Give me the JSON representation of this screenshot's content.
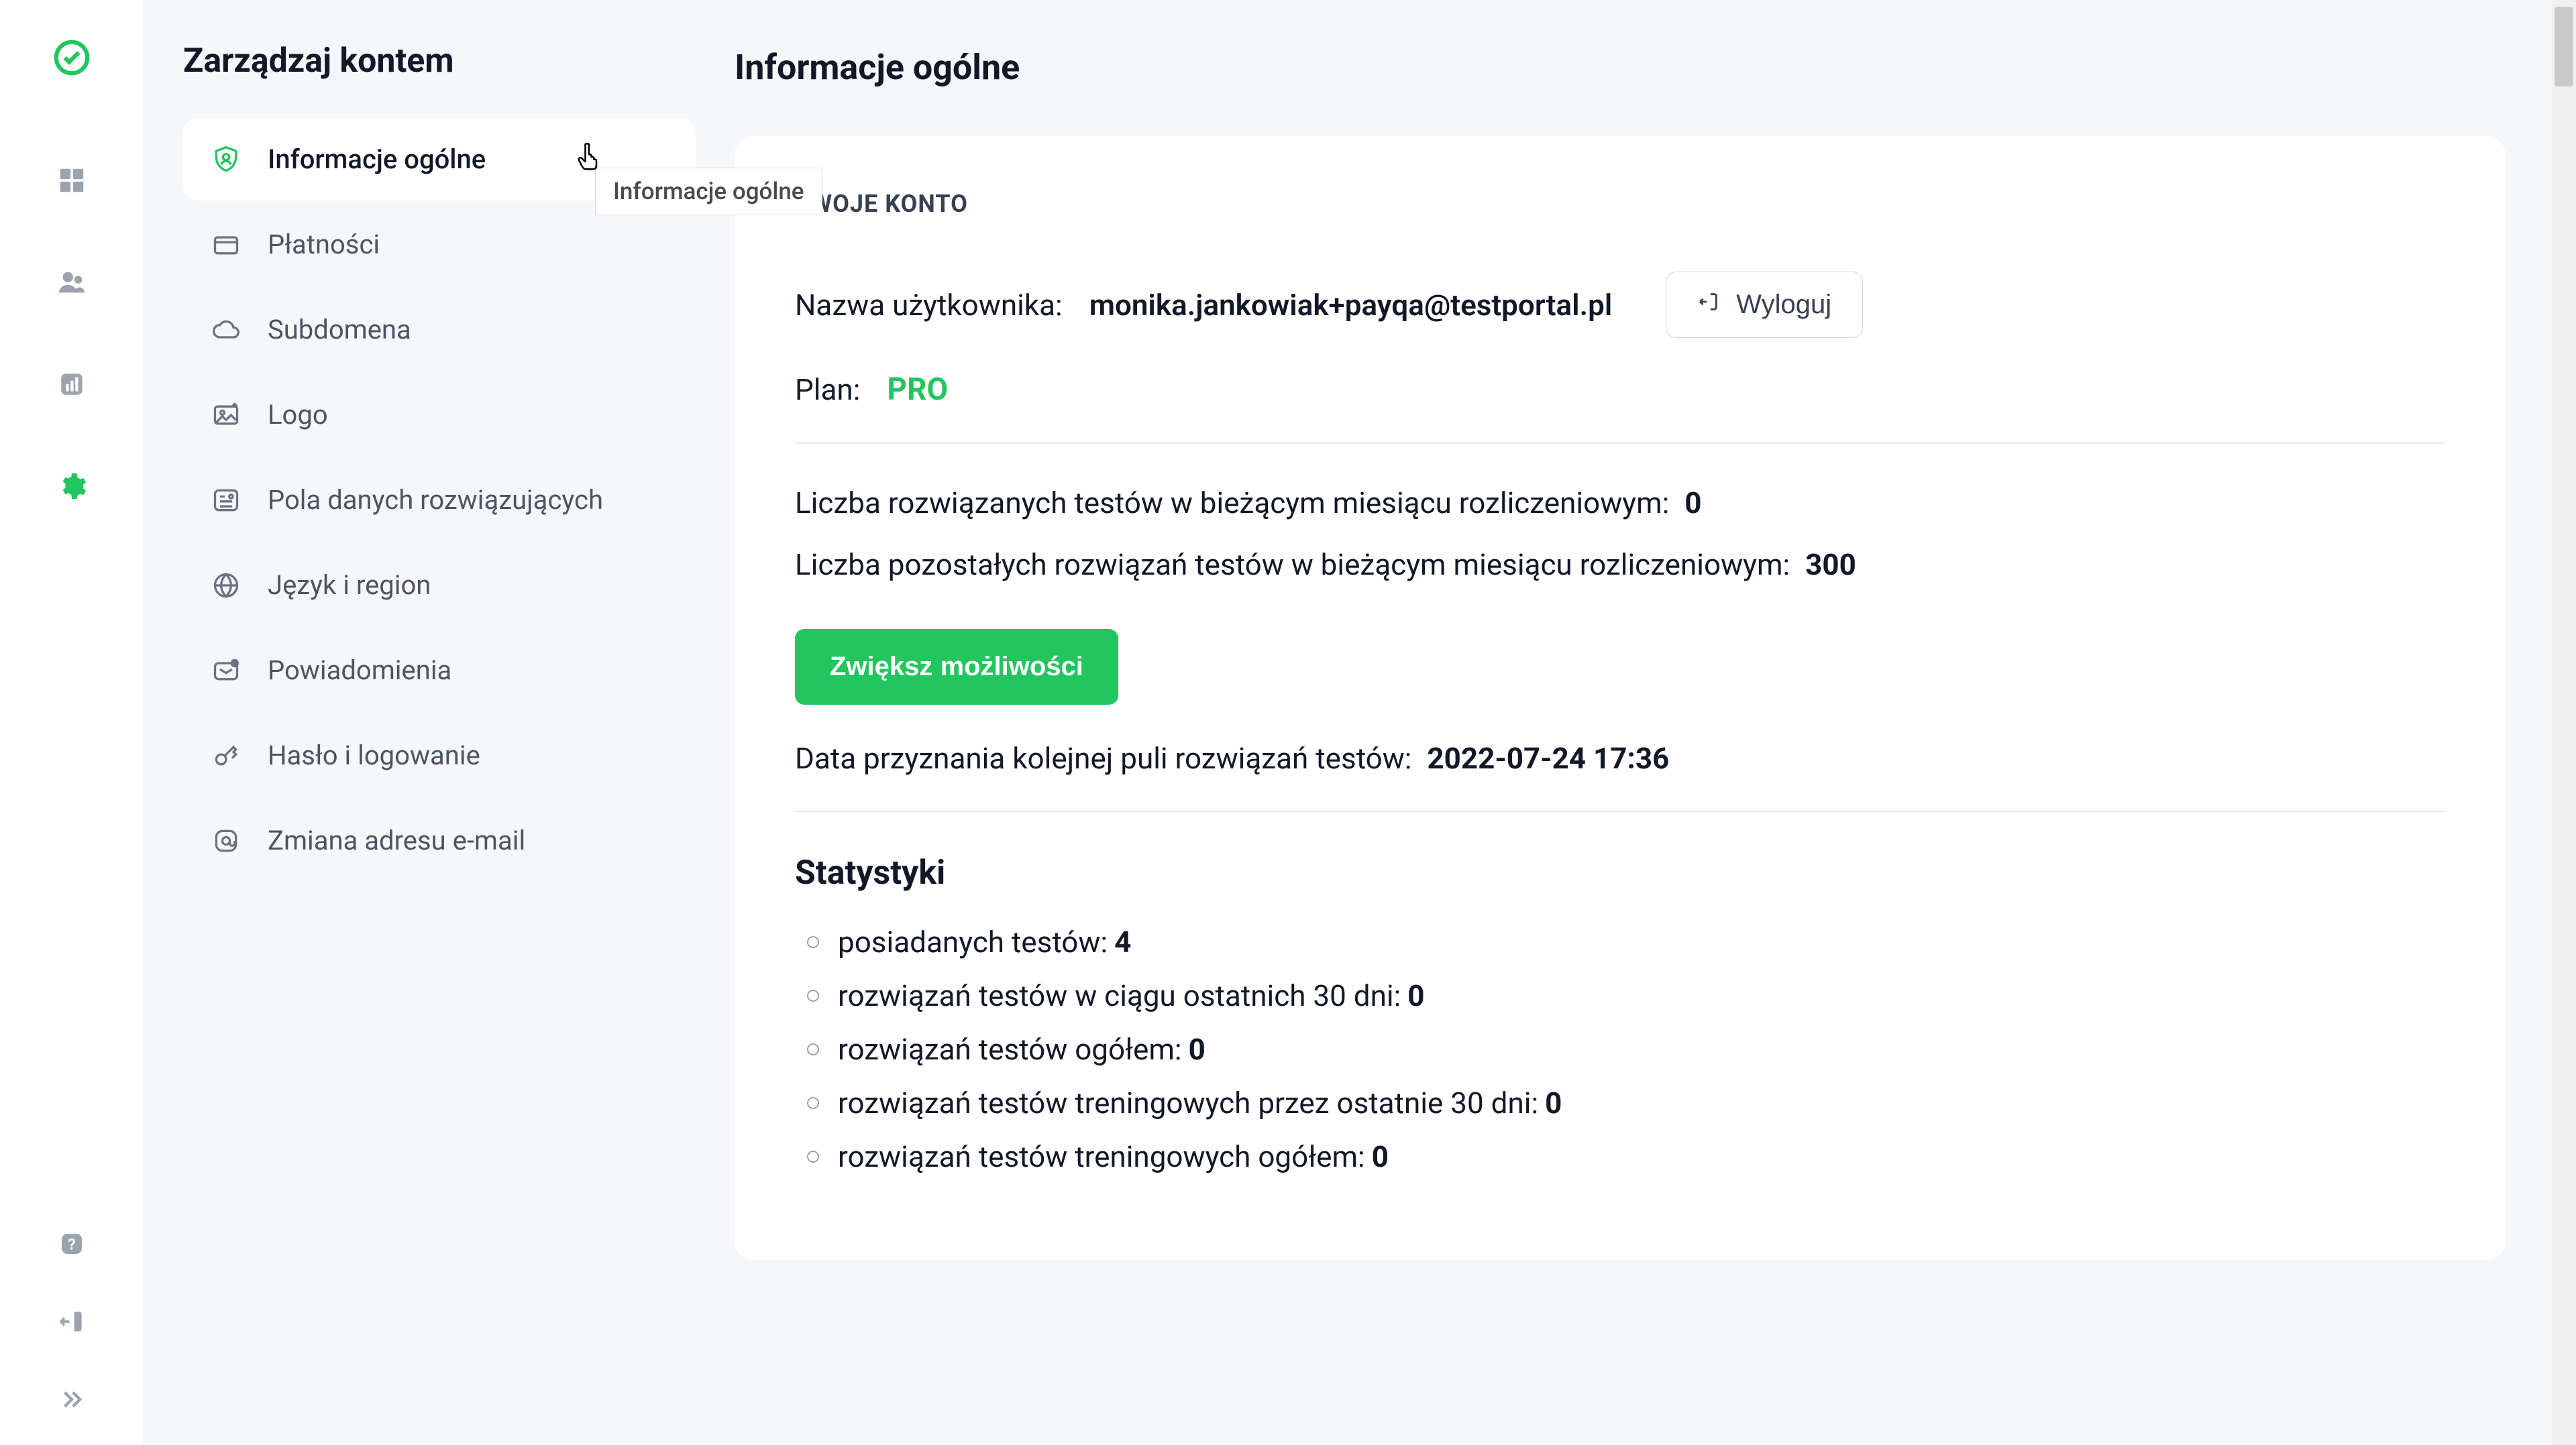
{
  "sidebar_title": "Zarządzaj kontem",
  "page_title": "Informacje ogólne",
  "tooltip_text": "Informacje ogólne",
  "settings_menu": {
    "items": [
      {
        "label": "Informacje ogólne"
      },
      {
        "label": "Płatności"
      },
      {
        "label": "Subdomena"
      },
      {
        "label": "Logo"
      },
      {
        "label": "Pola danych rozwiązujących"
      },
      {
        "label": "Język i region"
      },
      {
        "label": "Powiadomienia"
      },
      {
        "label": "Hasło i logowanie"
      },
      {
        "label": "Zmiana adresu e-mail"
      }
    ]
  },
  "card": {
    "heading": "TWOJE KONTO",
    "username_label": "Nazwa użytkownika:",
    "username_value": "monika.jankowiak+payqa@testportal.pl",
    "logout_label": "Wyloguj",
    "plan_label": "Plan:",
    "plan_value": "PRO",
    "solved_label": "Liczba rozwiązanych testów w bieżącym miesiącu rozliczeniowym:",
    "solved_value": "0",
    "remaining_label": "Liczba pozostałych rozwiązań testów w bieżącym miesiącu rozliczeniowym:",
    "remaining_value": "300",
    "upgrade_label": "Zwiększ możliwości",
    "next_pool_label": "Data przyznania kolejnej puli rozwiązań testów:",
    "next_pool_value": "2022-07-24 17:36",
    "stats_heading": "Statystyki",
    "stats": [
      {
        "label": "posiadanych testów: ",
        "value": "4"
      },
      {
        "label": "rozwiązań testów w ciągu ostatnich 30 dni: ",
        "value": "0"
      },
      {
        "label": "rozwiązań testów ogółem: ",
        "value": "0"
      },
      {
        "label": "rozwiązań testów treningowych przez ostatnie 30 dni: ",
        "value": "0"
      },
      {
        "label": "rozwiązań testów treningowych ogółem: ",
        "value": "0"
      }
    ]
  }
}
